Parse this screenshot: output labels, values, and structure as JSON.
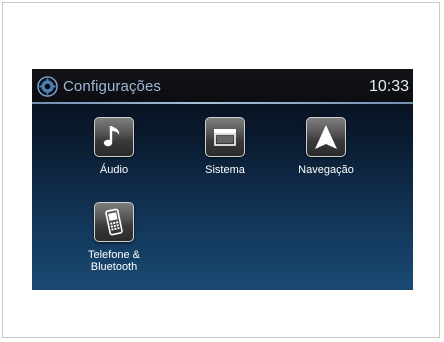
{
  "header": {
    "title": "Configurações",
    "time": "10:33",
    "icon": "settings-gear-icon"
  },
  "menu": {
    "items": [
      {
        "label": "Áudio",
        "icon": "music-note-icon"
      },
      {
        "label": "Sistema",
        "icon": "system-box-icon"
      },
      {
        "label": "Navegação",
        "icon": "navigation-arrow-icon"
      },
      {
        "label": "Telefone &\nBluetooth",
        "icon": "phone-icon"
      }
    ]
  },
  "colors": {
    "title_text": "#9fb7d6",
    "clock_text": "#e9eef5",
    "background_top": "#050a14",
    "background_bottom": "#1a4a73"
  }
}
